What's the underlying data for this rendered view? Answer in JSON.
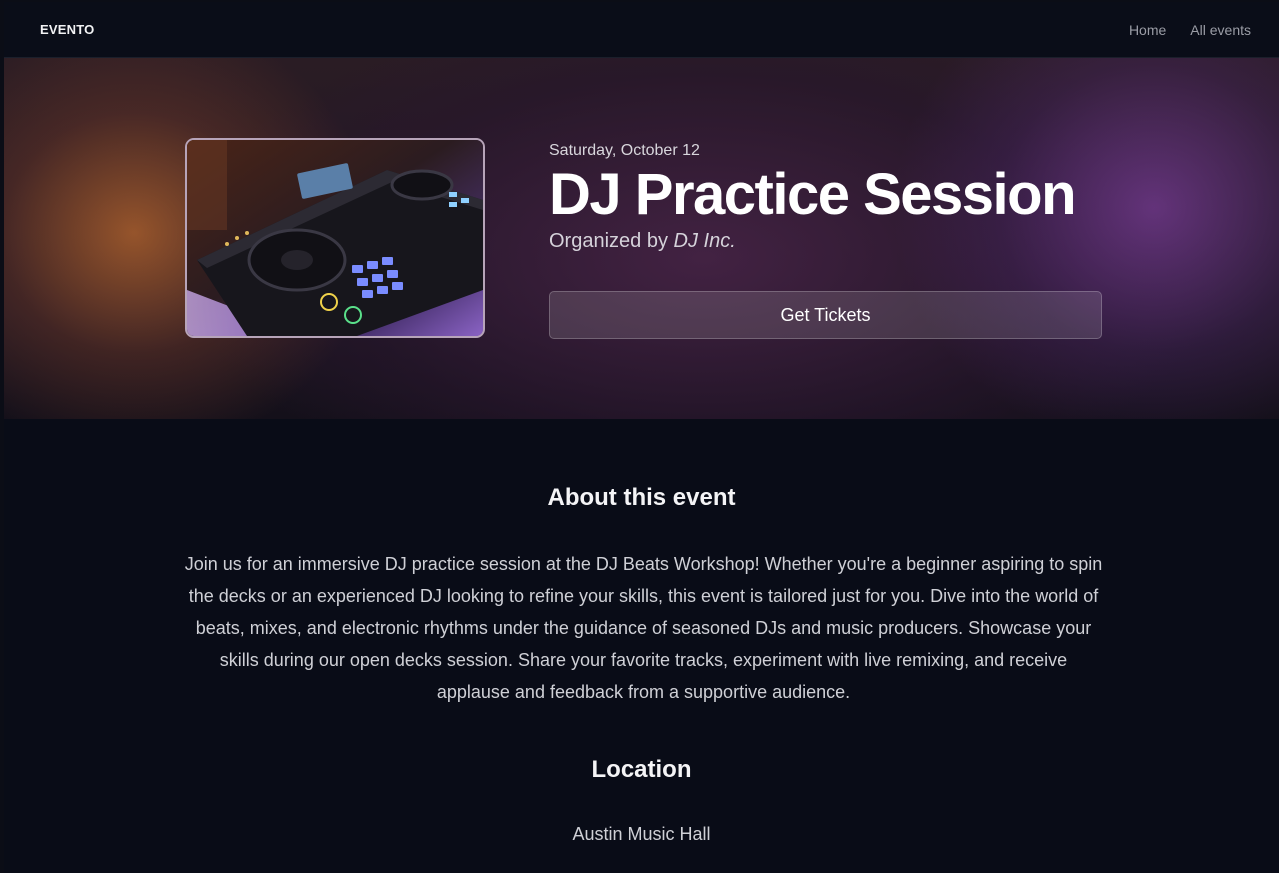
{
  "nav": {
    "logo": "EVENTO",
    "links": [
      "Home",
      "All events"
    ]
  },
  "event": {
    "date": "Saturday, October 12",
    "title": "DJ Practice Session",
    "organizer_prefix": "Organized by",
    "organizer_name": "DJ Inc.",
    "ticket_button": "Get Tickets",
    "image_icon": "dj-controller-photo"
  },
  "about": {
    "heading": "About this event",
    "description": "Join us for an immersive DJ practice session at the DJ Beats Workshop! Whether you're a beginner aspiring to spin the decks or an experienced DJ looking to refine your skills, this event is tailored just for you. Dive into the world of beats, mixes, and electronic rhythms under the guidance of seasoned DJs and music producers. Showcase your skills during our open decks session. Share your favorite tracks, experiment with live remixing, and receive applause and feedback from a supportive audience."
  },
  "location": {
    "heading": "Location",
    "venue": "Austin Music Hall"
  },
  "colors": {
    "background": "#090c17",
    "hero_warm": "#aa5f2d",
    "hero_cool": "#783c96",
    "text_primary": "#ffffff",
    "text_muted": "#9b9da6"
  }
}
